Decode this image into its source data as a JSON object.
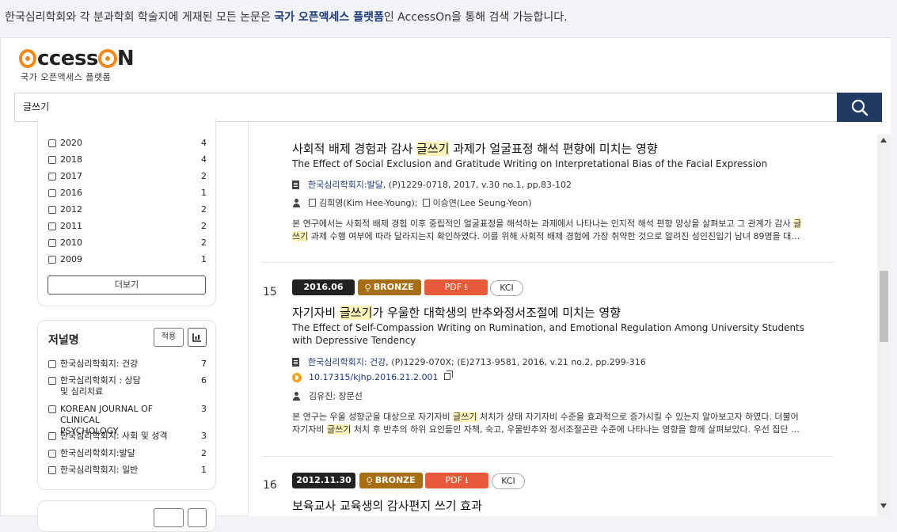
{
  "notice": {
    "prefix": "한국심리학회와 각 분과학회 학술지에 게재된 모든 논문은 ",
    "link": "국가 오픈액세스 플랫폼",
    "suffix": "인 AccessOn을 통해 검색 가능합니다."
  },
  "logo": {
    "text_a": "A",
    "text_mid": "ccess",
    "text_o": "O",
    "text_n": "N",
    "sub": "국가 오픈액세스 플랫폼"
  },
  "search": {
    "value": "글쓰기",
    "button_icon": "search-icon"
  },
  "year_facet": {
    "items": [
      {
        "label": "2020",
        "count": "4"
      },
      {
        "label": "2018",
        "count": "4"
      },
      {
        "label": "2017",
        "count": "2"
      },
      {
        "label": "2016",
        "count": "1"
      },
      {
        "label": "2012",
        "count": "2"
      },
      {
        "label": "2011",
        "count": "2"
      },
      {
        "label": "2010",
        "count": "2"
      },
      {
        "label": "2009",
        "count": "1"
      }
    ],
    "more": "더보기"
  },
  "journal_facet": {
    "title": "저널명",
    "apply": "적용",
    "items": [
      {
        "label": "한국심리학회지: 건강",
        "count": "7"
      },
      {
        "label": "한국심리학회지 : 상담 및 심리치료",
        "count": "6"
      },
      {
        "label": "KOREAN JOURNAL OF CLINICAL PSYCHOLOGY",
        "count": "3"
      },
      {
        "label": "한국심리학회지: 사회 및 성격",
        "count": "3"
      },
      {
        "label": "한국심리학회지:발달",
        "count": "2"
      },
      {
        "label": "한국심리학회지: 일반",
        "count": "1"
      }
    ]
  },
  "results": [
    {
      "title_pre": "사회적 배제 경험과 감사 ",
      "title_hl": "글쓰기",
      "title_post": " 과제가 얼굴표정 해석 편향에 미치는 영향",
      "title_en": "The Effect of Social Exclusion and Gratitude Writing on Interpretational Bias of the Facial Expression",
      "journal": "한국심리학회지:발달",
      "pub": ", (P)1229-0718, 2017, v.30 no.1, pp.83-102",
      "authors_a": "김희영(Kim Hee-Young);",
      "authors_b": "이승연(Lee Seung-Yeon)",
      "abs1_pre": "본 연구에서는 사회적 배제 경험 이후 중립적인 얼굴표정을 해석하는 과제에서 나타나는 인지적 해석 편향 양상을 살펴보고 그 관계가 감사 ",
      "abs1_hl": "글",
      "abs2_hl": "쓰기",
      "abs2_post": " 과제 수행 여부에 따라 달라지는지 확인하였다. 이를 위해 사회적 배제 경험에 가장 취약한 것으로 알려진 성인진입기 남녀 89명을 대…"
    },
    {
      "number": "15",
      "date": "2016.06",
      "oa": "BRONZE",
      "pdf": "PDF",
      "kci": "KCI",
      "title_pre": "자기자비 ",
      "title_hl": "글쓰기",
      "title_post": "가 우울한 대학생의 반추와정서조절에 미치는 영향",
      "title_en": "The Effect of Self-Compassion Writing on Rumination, and Emotional Regulation Among University Students with Depressive Tendency",
      "journal": "한국심리학회지: 건강",
      "pub": ", (P)1229-070X; (E)2713-9581, 2016, v.21 no.2, pp.299-316",
      "doi": "10.17315/kjhp.2016.21.2.001",
      "authors": "김유진;  장문선",
      "abs1_pre": "본 연구는 우울 성향군을 대상으로 자기자비 ",
      "abs1_hl": "글쓰기",
      "abs1_post": " 처치가 상태 자기자비 수준을 효과적으로 증가시킬 수 있는지 알아보고자 하였다. 더불어",
      "abs2_pre": "자기자비 ",
      "abs2_hl": "글쓰기",
      "abs2_post": " 처치 후 반추의 하위 요인들인 자책, 숙고, 우울반추와 정서조절곤란 수준에 나타나는 영향을 함께 살펴보았다. 우선 집단 …"
    },
    {
      "number": "16",
      "date": "2012.11.30",
      "oa": "BRONZE",
      "pdf": "PDF",
      "kci": "KCI",
      "title": "보육교사 교육생의 감사편지 쓰기 효과"
    }
  ]
}
